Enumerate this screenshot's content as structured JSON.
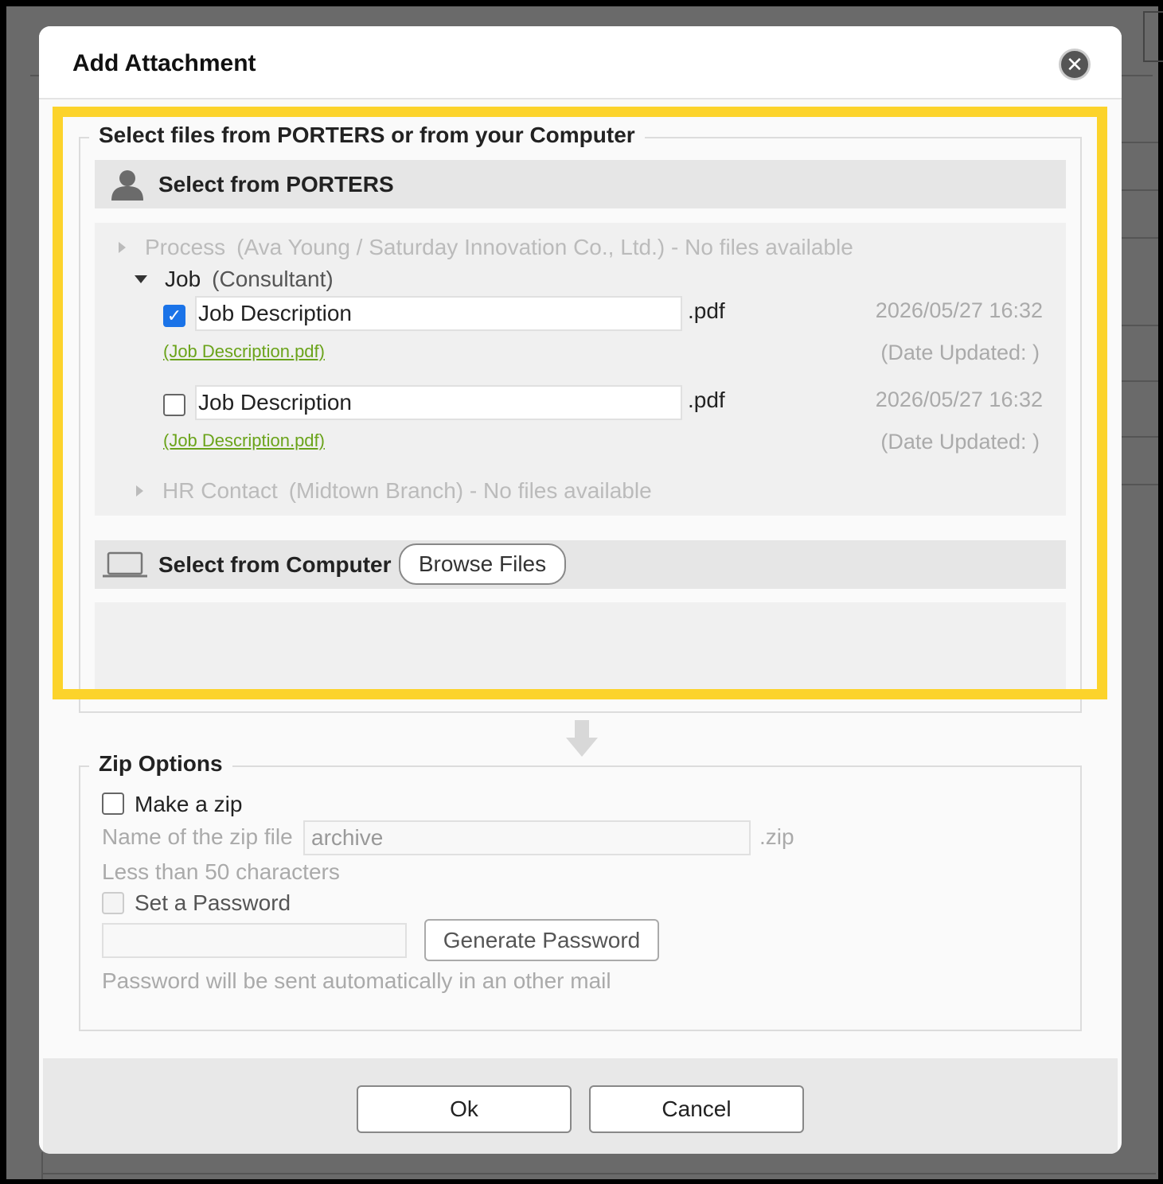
{
  "dialog": {
    "title": "Add Attachment",
    "close_icon": "close-icon"
  },
  "select_files": {
    "legend": "Select files from PORTERS or from your Computer",
    "porters": {
      "label": "Select from PORTERS",
      "icon": "person-icon",
      "process": {
        "name": "Process",
        "detail": "(Ava Young / Saturday Innovation Co., Ltd.) - No files available"
      },
      "job": {
        "name": "Job",
        "detail": "(Consultant)",
        "files": [
          {
            "checked": true,
            "name": "Job Description",
            "ext": ".pdf",
            "link": "(Job Description.pdf)",
            "date": "2026/05/27 16:32",
            "date_updated": "(Date Updated: )"
          },
          {
            "checked": false,
            "name": "Job Description",
            "ext": ".pdf",
            "link": "(Job Description.pdf)",
            "date": "2026/05/27 16:32",
            "date_updated": "(Date Updated: )"
          }
        ]
      },
      "hr_contact": {
        "name": "HR Contact",
        "detail": "(Midtown Branch) - No files available"
      }
    },
    "computer": {
      "label": "Select from Computer",
      "icon": "laptop-icon",
      "browse_label": "Browse Files"
    }
  },
  "zip": {
    "legend": "Zip Options",
    "make_zip_label": "Make a zip",
    "name_label": "Name of the zip file",
    "name_value": "archive",
    "ext": ".zip",
    "hint": "Less than 50 characters",
    "password_label": "Set a Password",
    "password_value": "",
    "generate_label": "Generate Password",
    "password_note": "Password will be sent automatically in an other mail"
  },
  "footer": {
    "ok_label": "Ok",
    "cancel_label": "Cancel"
  },
  "colors": {
    "highlight": "#fcd32b",
    "link": "#6aa31a",
    "checkbox": "#1a73e8"
  }
}
